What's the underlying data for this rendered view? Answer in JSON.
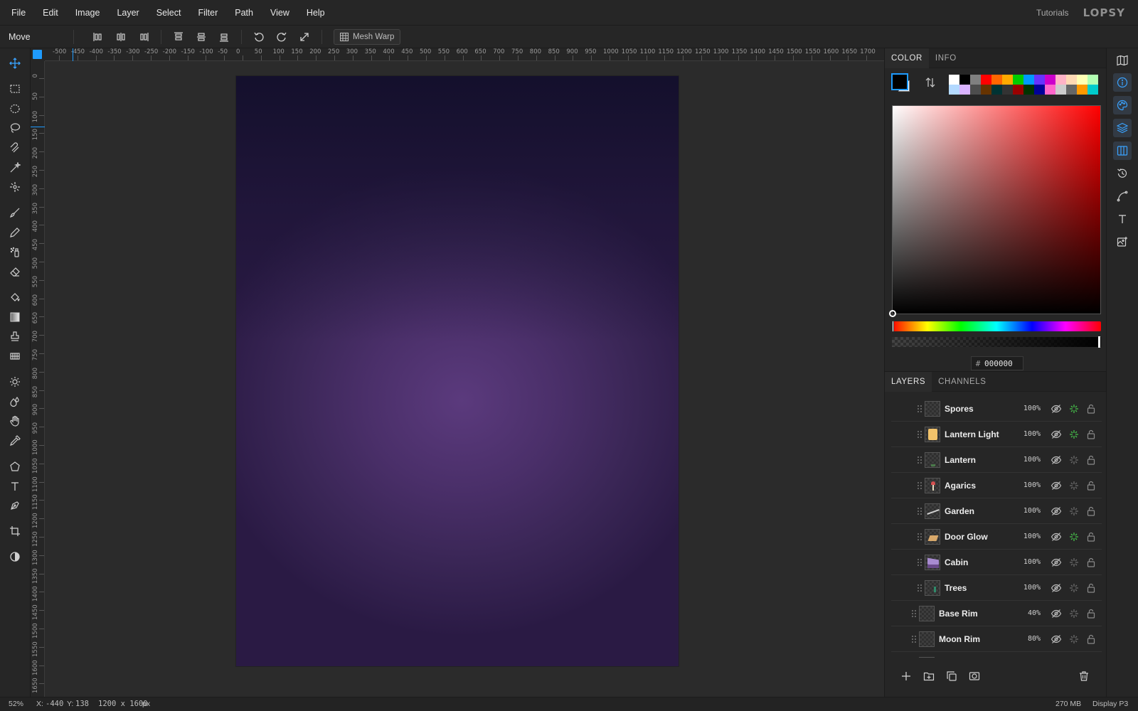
{
  "menu": [
    "File",
    "Edit",
    "Image",
    "Layer",
    "Select",
    "Filter",
    "Path",
    "View",
    "Help"
  ],
  "header": {
    "tutorials": "Tutorials",
    "logo": "LOPSY"
  },
  "options": {
    "tool_name": "Move",
    "mesh_warp": "Mesh Warp"
  },
  "ruler": {
    "h_ticks": [
      "-500",
      "-450",
      "-400",
      "-350",
      "-300",
      "-250",
      "-200",
      "-150",
      "-100",
      "-50",
      "0",
      "50",
      "100",
      "150",
      "200",
      "250",
      "300",
      "350",
      "400",
      "450",
      "500",
      "550",
      "600",
      "650",
      "700",
      "750",
      "800",
      "850",
      "900",
      "950",
      "1000",
      "1050",
      "1100",
      "1150",
      "1200",
      "1250",
      "1300",
      "1350",
      "1400",
      "1450",
      "1500",
      "1550",
      "1600",
      "1650",
      "1700"
    ],
    "v_ticks": [
      "0",
      "50",
      "100",
      "150",
      "200",
      "250",
      "300",
      "350",
      "400",
      "450",
      "500",
      "550",
      "600",
      "650",
      "700",
      "750",
      "800",
      "850",
      "900",
      "950",
      "1000",
      "1050",
      "1100",
      "1150",
      "1200",
      "1250",
      "1300",
      "1350",
      "1400",
      "1450",
      "1500",
      "1550",
      "1600",
      "1650"
    ]
  },
  "color_panel": {
    "tabs": [
      "COLOR",
      "INFO"
    ],
    "hex": "000000",
    "hash": "#",
    "fg_color": "#000000",
    "bg_color": "#ffffff",
    "palette": [
      "#ffffff",
      "#000000",
      "#808080",
      "#ff0000",
      "#ff6600",
      "#ffaa00",
      "#00cc00",
      "#0099ff",
      "#6633ff",
      "#cc00cc",
      "#ffb3c6",
      "#ffd9b3",
      "#ffffb3",
      "#b3ffb3",
      "#b3d9ff",
      "#d9b3ff",
      "#4d4d4d",
      "#663300",
      "#003333",
      "#333333",
      "#990000",
      "#003300",
      "#000099",
      "#ff66cc",
      "#cccccc",
      "#666666",
      "#ff9900",
      "#00cccc"
    ]
  },
  "layers_panel": {
    "tabs": [
      "LAYERS",
      "CHANNELS"
    ],
    "layers": [
      {
        "name": "Spores",
        "opacity": "100%",
        "fx": true
      },
      {
        "name": "Lantern Light",
        "opacity": "100%",
        "fx": true
      },
      {
        "name": "Lantern",
        "opacity": "100%",
        "fx": false
      },
      {
        "name": "Agarics",
        "opacity": "100%",
        "fx": false
      },
      {
        "name": "Garden",
        "opacity": "100%",
        "fx": false
      },
      {
        "name": "Door Glow",
        "opacity": "100%",
        "fx": true
      },
      {
        "name": "Cabin",
        "opacity": "100%",
        "fx": false
      },
      {
        "name": "Trees",
        "opacity": "100%",
        "fx": false
      },
      {
        "name": "Base Rim",
        "opacity": "40%",
        "fx": false
      },
      {
        "name": "Moon Rim",
        "opacity": "80%",
        "fx": false
      }
    ]
  },
  "status": {
    "zoom": "52%",
    "x_label": "X:",
    "x": "-440",
    "y_label": "Y:",
    "y": "138",
    "dims": "1200 x 1600",
    "dims_unit": "px",
    "memory": "270 MB",
    "profile": "Display P3"
  }
}
